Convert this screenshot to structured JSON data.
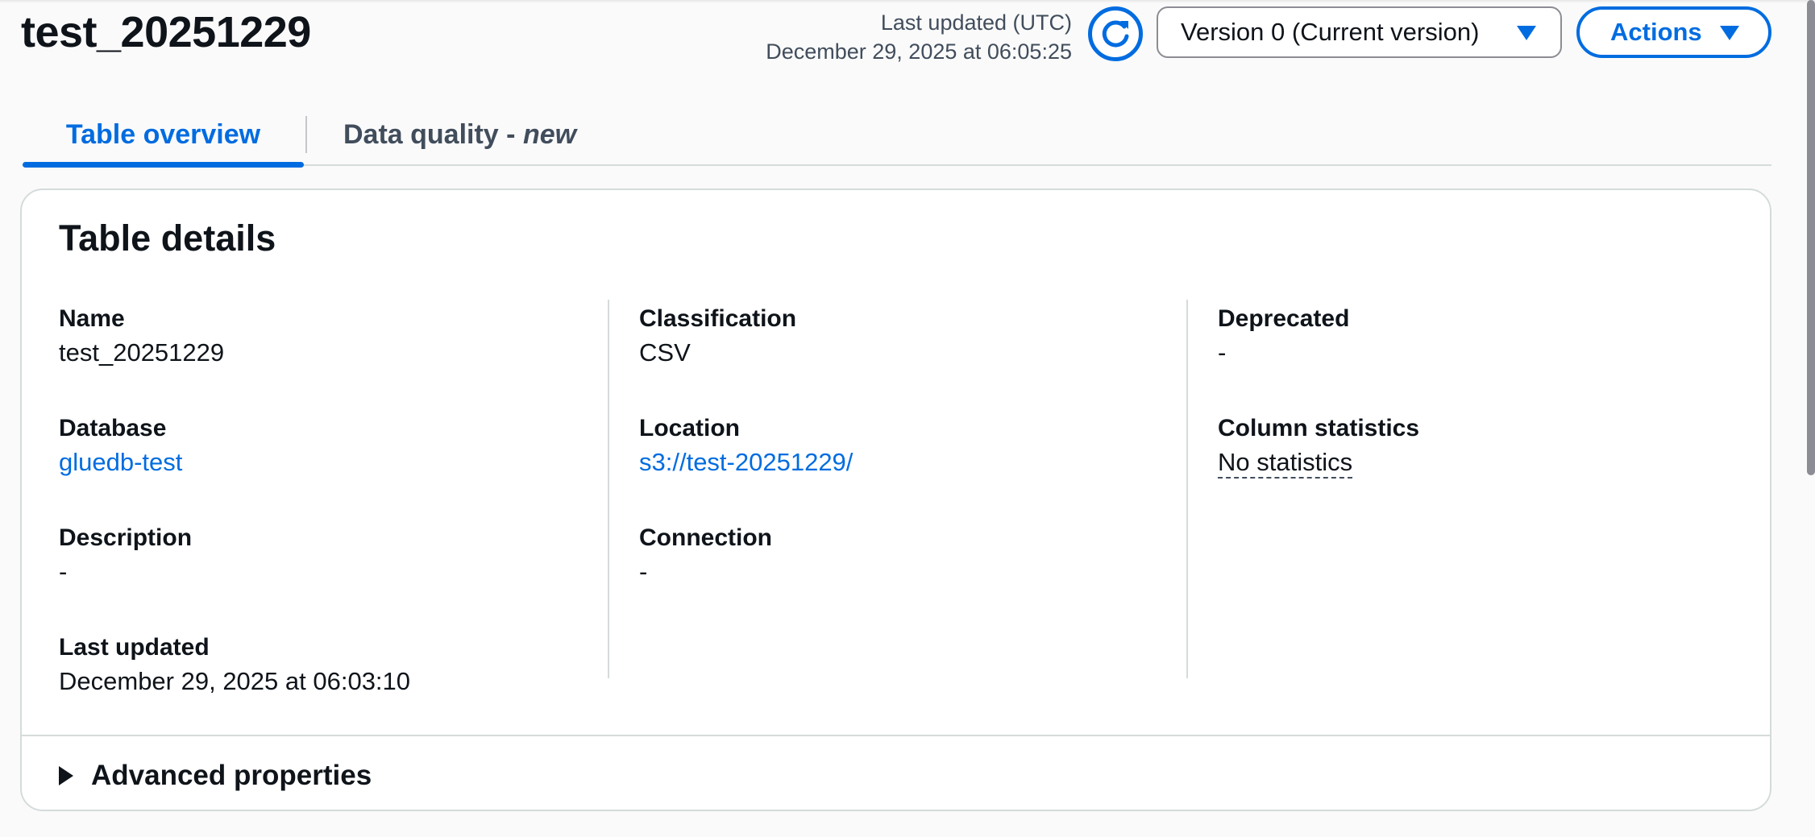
{
  "header": {
    "title": "test_20251229",
    "last_updated_label": "Last updated (UTC)",
    "last_updated_value": "December 29, 2025 at 06:05:25",
    "version_label": "Version 0 (Current version)",
    "actions_label": "Actions"
  },
  "tabs": {
    "overview": "Table overview",
    "quality_prefix": "Data quality - ",
    "quality_suffix": "new"
  },
  "card": {
    "title": "Table details",
    "advanced_label": "Advanced properties"
  },
  "fields": {
    "name_label": "Name",
    "name_value": "test_20251229",
    "database_label": "Database",
    "database_value": "gluedb-test",
    "description_label": "Description",
    "description_value": "-",
    "last_updated_label": "Last updated",
    "last_updated_value": "December 29, 2025 at 06:03:10",
    "classification_label": "Classification",
    "classification_value": "CSV",
    "location_label": "Location",
    "location_value": "s3://test-20251229/",
    "connection_label": "Connection",
    "connection_value": "-",
    "deprecated_label": "Deprecated",
    "deprecated_value": "-",
    "column_stats_label": "Column statistics",
    "column_stats_value": "No statistics"
  },
  "colors": {
    "accent": "#006ce0",
    "text": "#0f141a",
    "border": "#d5dbdb"
  },
  "icons": {
    "refresh": "refresh-icon",
    "dropdown": "caret-down-icon",
    "expand": "caret-right-icon"
  }
}
